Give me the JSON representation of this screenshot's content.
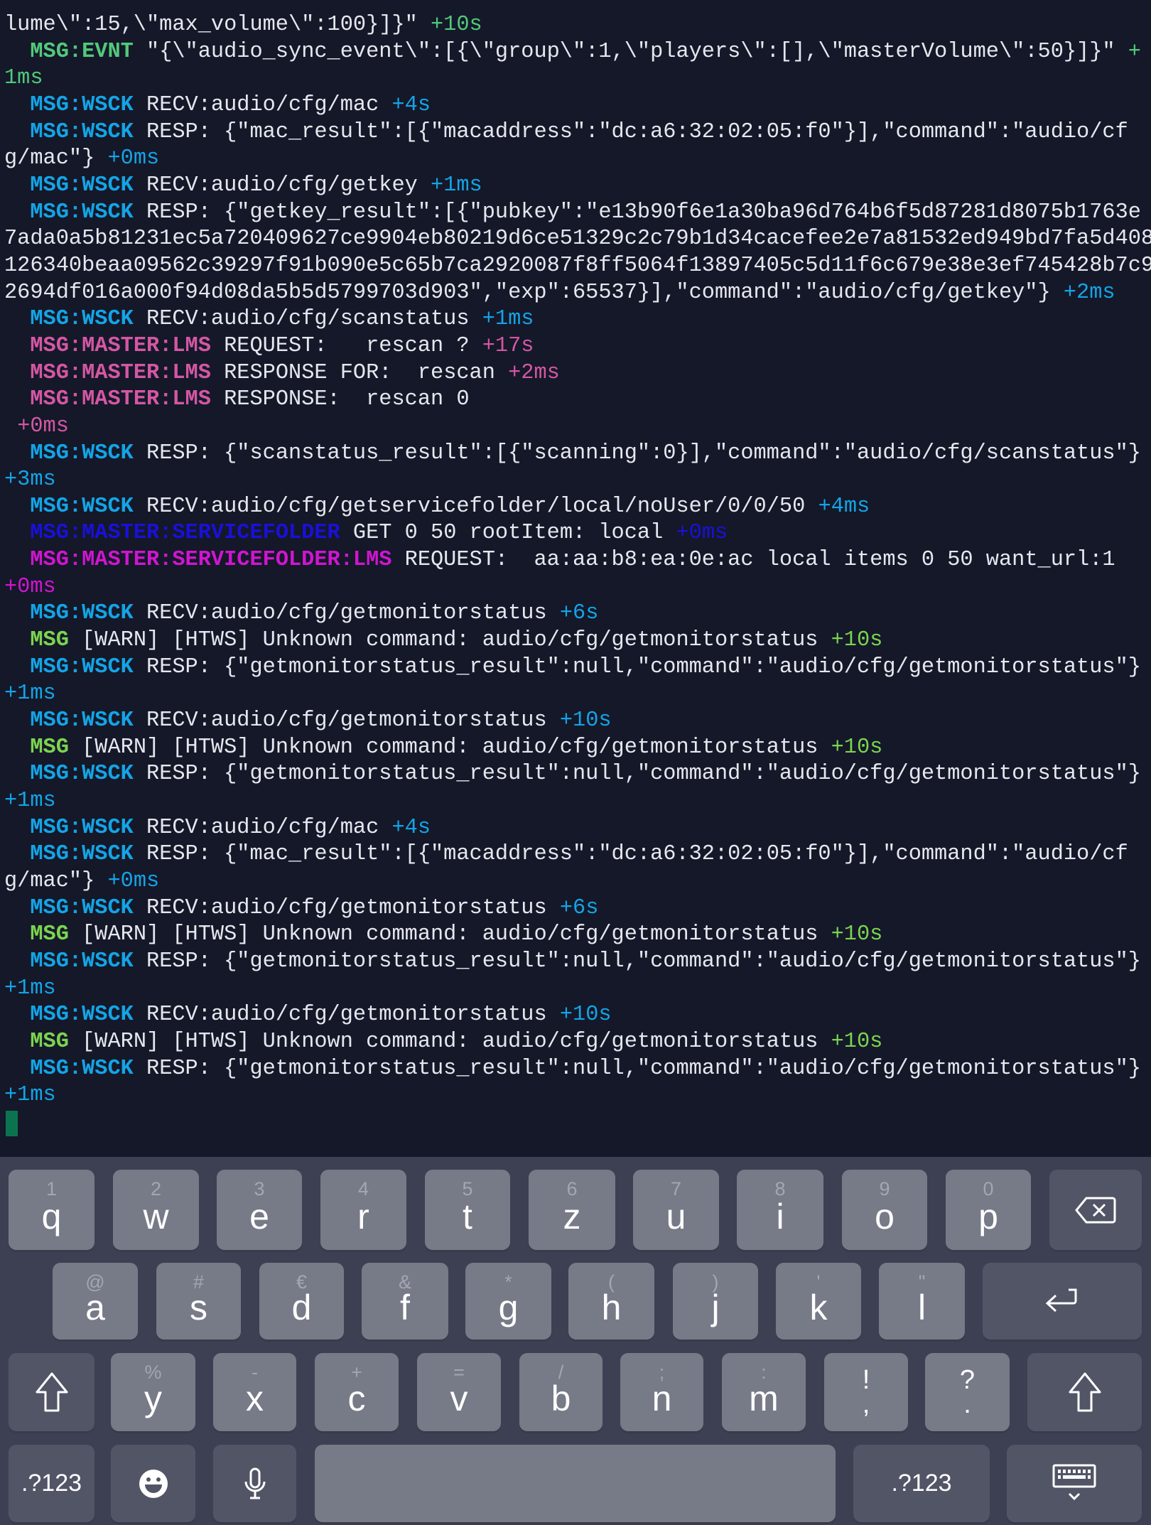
{
  "colors": {
    "evnt": "#52c97a",
    "wsck": "#14a4e6",
    "lms": "#d457a3",
    "servicefolder": "#1a10d8",
    "servicefolder_lms": "#d015d0",
    "warn": "#7bd44f",
    "text": "#e6e7ee",
    "cursor": "#0c7350"
  },
  "terminal": {
    "entries": [
      {
        "tag": "",
        "color": "evnt",
        "body": "lume\\\":15,\\\"max_volume\\\":100}]}\"",
        "time": "+10s",
        "indent": false
      },
      {
        "tag": "MSG:EVNT",
        "color": "evnt",
        "body": "\"{\\\"audio_sync_event\\\":[{\\\"group\\\":1,\\\"players\\\":[],\\\"masterVolume\\\":50}]}\"",
        "time": "+1ms"
      },
      {
        "tag": "MSG:WSCK",
        "color": "wsck",
        "body": "RECV:audio/cfg/mac",
        "time": "+4s"
      },
      {
        "tag": "MSG:WSCK",
        "color": "wsck",
        "body": "RESP: {\"mac_result\":[{\"macaddress\":\"dc:a6:32:02:05:f0\"}],\"command\":\"audio/cfg/mac\"}",
        "time": "+0ms"
      },
      {
        "tag": "MSG:WSCK",
        "color": "wsck",
        "body": "RECV:audio/cfg/getkey",
        "time": "+1ms"
      },
      {
        "tag": "MSG:WSCK",
        "color": "wsck",
        "body": "RESP: {\"getkey_result\":[{\"pubkey\":\"e13b90f6e1a30ba96d764b6f5d87281d8075b1763e7ada0a5b81231ec5a720409627ce9904eb80219d6ce51329c2c79b1d34cacefee2e7a81532ed949bd7fa5d408126340beaa09562c39297f91b090e5c65b7ca2920087f8ff5064f13897405c5d11f6c679e38e3ef745428b7c92694df016a000f94d08da5b5d5799703d903\",\"exp\":65537}],\"command\":\"audio/cfg/getkey\"}",
        "time": "+2ms"
      },
      {
        "tag": "MSG:WSCK",
        "color": "wsck",
        "body": "RECV:audio/cfg/scanstatus",
        "time": "+1ms"
      },
      {
        "tag": "MSG:MASTER:LMS",
        "color": "lms",
        "body": "REQUEST:   rescan ?",
        "time": "+17s"
      },
      {
        "tag": "MSG:MASTER:LMS",
        "color": "lms",
        "body": "RESPONSE FOR:  rescan",
        "time": "+2ms"
      },
      {
        "tag": "MSG:MASTER:LMS",
        "color": "lms",
        "body": "RESPONSE:  rescan 0\n",
        "time": "+0ms"
      },
      {
        "tag": "MSG:WSCK",
        "color": "wsck",
        "body": "RESP: {\"scanstatus_result\":[{\"scanning\":0}],\"command\":\"audio/cfg/scanstatus\"}",
        "time": "+3ms"
      },
      {
        "tag": "MSG:WSCK",
        "color": "wsck",
        "body": "RECV:audio/cfg/getservicefolder/local/noUser/0/0/50",
        "time": "+4ms"
      },
      {
        "tag": "MSG:MASTER:SERVICEFOLDER",
        "color": "servicefolder",
        "body": "GET 0 50 rootItem: local",
        "time": "+0ms"
      },
      {
        "tag": "MSG:MASTER:SERVICEFOLDER:LMS",
        "color": "servicefolder_lms",
        "body": "REQUEST:  aa:aa:b8:ea:0e:ac local items 0 50 want_url:1  ",
        "time": "+0ms"
      },
      {
        "tag": "MSG:WSCK",
        "color": "wsck",
        "body": "RECV:audio/cfg/getmonitorstatus",
        "time": "+6s"
      },
      {
        "tag": "MSG",
        "color": "warn",
        "body": "[WARN] [HTWS] Unknown command: audio/cfg/getmonitorstatus",
        "time": "+10s"
      },
      {
        "tag": "MSG:WSCK",
        "color": "wsck",
        "body": "RESP: {\"getmonitorstatus_result\":null,\"command\":\"audio/cfg/getmonitorstatus\"}",
        "time": "+1ms"
      },
      {
        "tag": "MSG:WSCK",
        "color": "wsck",
        "body": "RECV:audio/cfg/getmonitorstatus",
        "time": "+10s"
      },
      {
        "tag": "MSG",
        "color": "warn",
        "body": "[WARN] [HTWS] Unknown command: audio/cfg/getmonitorstatus",
        "time": "+10s"
      },
      {
        "tag": "MSG:WSCK",
        "color": "wsck",
        "body": "RESP: {\"getmonitorstatus_result\":null,\"command\":\"audio/cfg/getmonitorstatus\"}",
        "time": "+1ms"
      },
      {
        "tag": "MSG:WSCK",
        "color": "wsck",
        "body": "RECV:audio/cfg/mac",
        "time": "+4s"
      },
      {
        "tag": "MSG:WSCK",
        "color": "wsck",
        "body": "RESP: {\"mac_result\":[{\"macaddress\":\"dc:a6:32:02:05:f0\"}],\"command\":\"audio/cfg/mac\"}",
        "time": "+0ms"
      },
      {
        "tag": "MSG:WSCK",
        "color": "wsck",
        "body": "RECV:audio/cfg/getmonitorstatus",
        "time": "+6s"
      },
      {
        "tag": "MSG",
        "color": "warn",
        "body": "[WARN] [HTWS] Unknown command: audio/cfg/getmonitorstatus",
        "time": "+10s"
      },
      {
        "tag": "MSG:WSCK",
        "color": "wsck",
        "body": "RESP: {\"getmonitorstatus_result\":null,\"command\":\"audio/cfg/getmonitorstatus\"}",
        "time": "+1ms"
      },
      {
        "tag": "MSG:WSCK",
        "color": "wsck",
        "body": "RECV:audio/cfg/getmonitorstatus",
        "time": "+10s"
      },
      {
        "tag": "MSG",
        "color": "warn",
        "body": "[WARN] [HTWS] Unknown command: audio/cfg/getmonitorstatus",
        "time": "+10s"
      },
      {
        "tag": "MSG:WSCK",
        "color": "wsck",
        "body": "RESP: {\"getmonitorstatus_result\":null,\"command\":\"audio/cfg/getmonitorstatus\"}",
        "time": "+1ms"
      }
    ]
  },
  "keyboard": {
    "rows": [
      [
        {
          "id": "q",
          "label": "q",
          "sub": "1"
        },
        {
          "id": "w",
          "label": "w",
          "sub": "2"
        },
        {
          "id": "e",
          "label": "e",
          "sub": "3"
        },
        {
          "id": "r",
          "label": "r",
          "sub": "4"
        },
        {
          "id": "t",
          "label": "t",
          "sub": "5"
        },
        {
          "id": "z",
          "label": "z",
          "sub": "6"
        },
        {
          "id": "u",
          "label": "u",
          "sub": "7"
        },
        {
          "id": "i",
          "label": "i",
          "sub": "8"
        },
        {
          "id": "o",
          "label": "o",
          "sub": "9"
        },
        {
          "id": "p",
          "label": "p",
          "sub": "0"
        },
        {
          "id": "backspace",
          "icon": "backspace-icon"
        }
      ],
      [
        {
          "id": "a",
          "label": "a",
          "sub": "@"
        },
        {
          "id": "s",
          "label": "s",
          "sub": "#"
        },
        {
          "id": "d",
          "label": "d",
          "sub": "€"
        },
        {
          "id": "f",
          "label": "f",
          "sub": "&"
        },
        {
          "id": "g",
          "label": "g",
          "sub": "*"
        },
        {
          "id": "h",
          "label": "h",
          "sub": "("
        },
        {
          "id": "j",
          "label": "j",
          "sub": ")"
        },
        {
          "id": "k",
          "label": "k",
          "sub": "'"
        },
        {
          "id": "l",
          "label": "l",
          "sub": "\""
        },
        {
          "id": "enter",
          "icon": "return-icon"
        }
      ],
      [
        {
          "id": "shift-left",
          "icon": "shift-icon"
        },
        {
          "id": "y",
          "label": "y",
          "sub": "%"
        },
        {
          "id": "x",
          "label": "x",
          "sub": "-"
        },
        {
          "id": "c",
          "label": "c",
          "sub": "+"
        },
        {
          "id": "v",
          "label": "v",
          "sub": "="
        },
        {
          "id": "b",
          "label": "b",
          "sub": "/"
        },
        {
          "id": "n",
          "label": "n",
          "sub": ";"
        },
        {
          "id": "m",
          "label": "m",
          "sub": ":"
        },
        {
          "id": "exclaim-comma",
          "top": "!",
          "bottom": ","
        },
        {
          "id": "question-period",
          "top": "?",
          "bottom": "."
        },
        {
          "id": "shift-right",
          "icon": "shift-icon"
        }
      ],
      [
        {
          "id": "symbols-left",
          "text": ".?123"
        },
        {
          "id": "emoji",
          "icon": "emoji-icon"
        },
        {
          "id": "mic",
          "icon": "microphone-icon"
        },
        {
          "id": "space",
          "label": ""
        },
        {
          "id": "symbols-right",
          "text": ".?123"
        },
        {
          "id": "hide-keyboard",
          "icon": "keyboard-hide-icon"
        }
      ]
    ]
  }
}
